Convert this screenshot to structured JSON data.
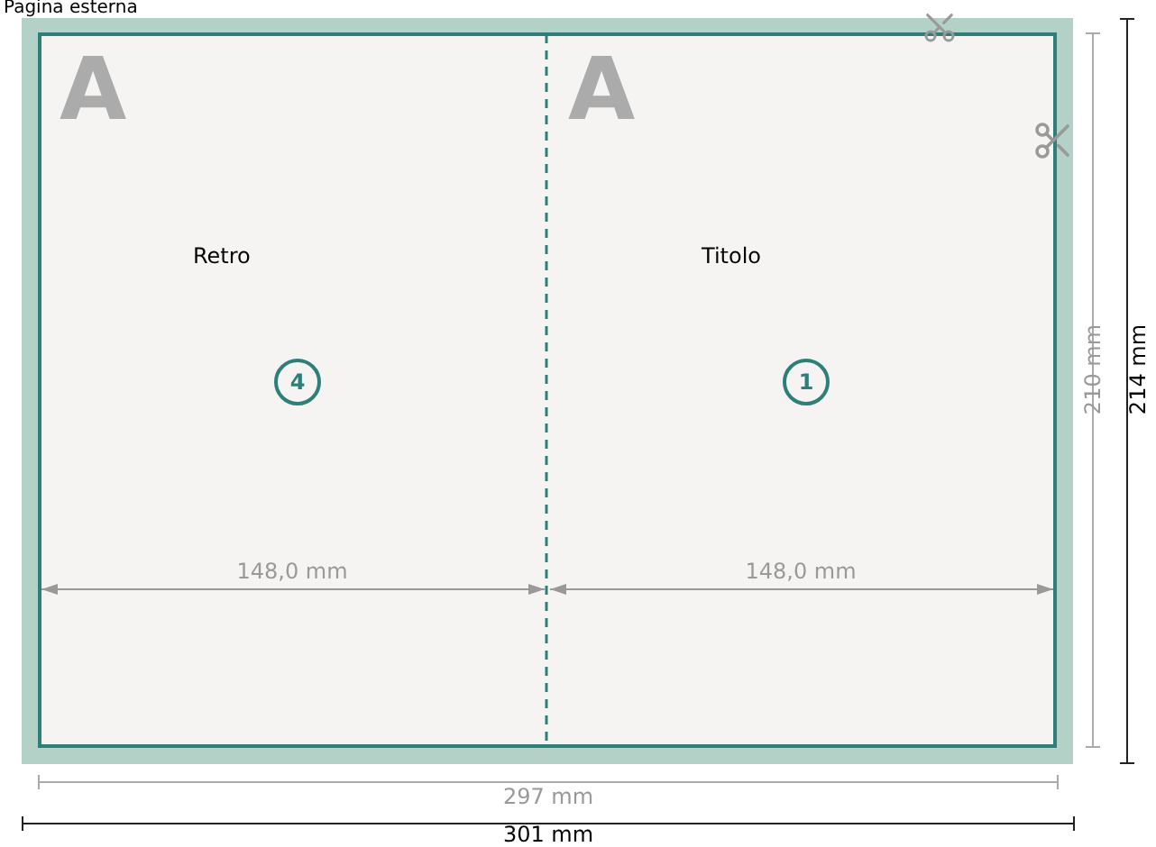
{
  "title": "Pagina esterna",
  "panels": [
    {
      "letter": "A",
      "label": "Retro",
      "page_number": "4",
      "width": "148,0 mm"
    },
    {
      "letter": "A",
      "label": "Titolo",
      "page_number": "1",
      "width": "148,0 mm"
    }
  ],
  "dimensions": {
    "trim_width": "297 mm",
    "bleed_width": "301 mm",
    "trim_height": "210 mm",
    "bleed_height": "214 mm"
  }
}
